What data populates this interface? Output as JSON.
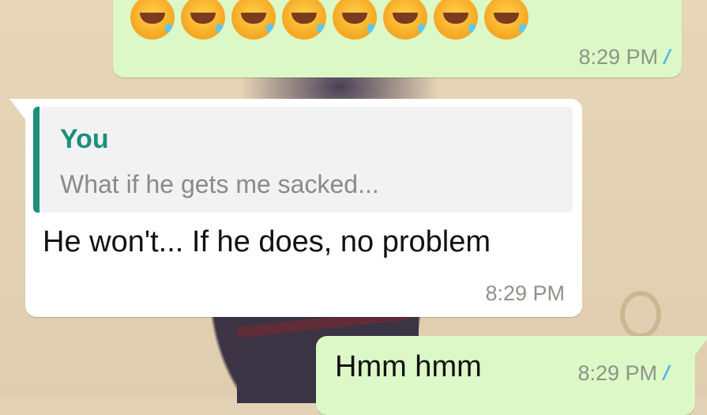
{
  "messages": [
    {
      "direction": "outgoing",
      "emoji_count": 8,
      "emoji_icon": "face-with-tears-of-joy",
      "time": "8:29 PM",
      "status_icon": "double-check-read"
    },
    {
      "direction": "incoming",
      "quote": {
        "author": "You",
        "text": "What if he gets me sacked..."
      },
      "text": "He won't... If he does, no problem",
      "time": "8:29 PM"
    },
    {
      "direction": "outgoing",
      "text": "Hmm hmm",
      "time": "8:29 PM",
      "status_icon": "double-check-read"
    }
  ],
  "colors": {
    "outgoing_bubble": "#dcf8c6",
    "incoming_bubble": "#ffffff",
    "quote_accent": "#1c8f7d",
    "read_ticks": "#4fb6ec"
  }
}
